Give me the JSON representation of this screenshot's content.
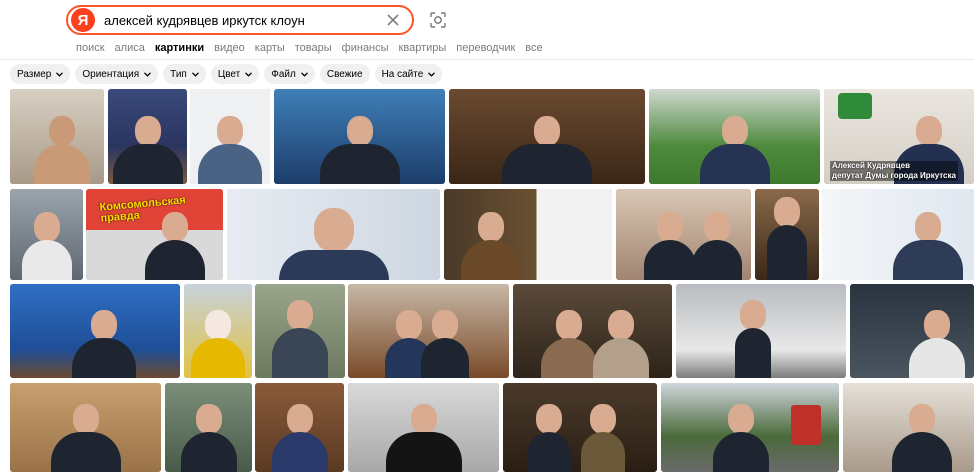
{
  "search": {
    "logo": "Я",
    "query": "алексей кудрявцев иркутск клоун"
  },
  "tabs": [
    {
      "label": "поиск",
      "active": false
    },
    {
      "label": "алиса",
      "active": false
    },
    {
      "label": "картинки",
      "active": true
    },
    {
      "label": "видео",
      "active": false
    },
    {
      "label": "карты",
      "active": false
    },
    {
      "label": "товары",
      "active": false
    },
    {
      "label": "финансы",
      "active": false
    },
    {
      "label": "квартиры",
      "active": false
    },
    {
      "label": "переводчик",
      "active": false
    },
    {
      "label": "все",
      "active": false
    }
  ],
  "filters": [
    {
      "label": "Размер",
      "dropdown": true
    },
    {
      "label": "Ориентация",
      "dropdown": true
    },
    {
      "label": "Тип",
      "dropdown": true
    },
    {
      "label": "Цвет",
      "dropdown": true
    },
    {
      "label": "Файл",
      "dropdown": true
    },
    {
      "label": "Свежие",
      "dropdown": false
    },
    {
      "label": "На сайте",
      "dropdown": true
    }
  ],
  "thumbnails": {
    "t7_caption": "Алексей Кудрявцев\nдепутат Думы города Иркутска",
    "t9_logo": "Комсомольская\nправда"
  },
  "colors": {
    "brand": "#fc3f1d",
    "search_border": "#ff5226",
    "chip_bg": "#f0f0f0",
    "tab_inactive": "#7b7b7b"
  }
}
